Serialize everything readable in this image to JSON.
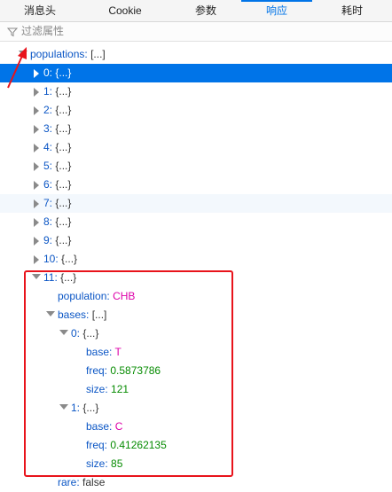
{
  "tabs": [
    {
      "label": "消息头",
      "selected": false
    },
    {
      "label": "Cookie",
      "selected": false
    },
    {
      "label": "参数",
      "selected": false
    },
    {
      "label": "响应",
      "selected": true
    },
    {
      "label": "耗时",
      "selected": false
    }
  ],
  "filter": {
    "placeholder": "过滤属性"
  },
  "tree": {
    "root": {
      "key": "populations:",
      "value": "[...]"
    },
    "items": [
      {
        "key": "0:",
        "value": "{...}"
      },
      {
        "key": "1:",
        "value": "{...}"
      },
      {
        "key": "2:",
        "value": "{...}"
      },
      {
        "key": "3:",
        "value": "{...}"
      },
      {
        "key": "4:",
        "value": "{...}"
      },
      {
        "key": "5:",
        "value": "{...}"
      },
      {
        "key": "6:",
        "value": "{...}"
      },
      {
        "key": "7:",
        "value": "{...}"
      },
      {
        "key": "8:",
        "value": "{...}"
      },
      {
        "key": "9:",
        "value": "{...}"
      },
      {
        "key": "10:",
        "value": "{...}"
      }
    ],
    "item11": {
      "key": "11:",
      "value": "{...}",
      "population": {
        "key": "population:",
        "value": "CHB"
      },
      "bases": {
        "key": "bases:",
        "value": "[...]",
        "b0": {
          "key": "0:",
          "value": "{...}",
          "base": {
            "key": "base:",
            "value": "T"
          },
          "freq": {
            "key": "freq:",
            "value": "0.5873786"
          },
          "size": {
            "key": "size:",
            "value": "121"
          }
        },
        "b1": {
          "key": "1:",
          "value": "{...}",
          "base": {
            "key": "base:",
            "value": "C"
          },
          "freq": {
            "key": "freq:",
            "value": "0.41262135"
          },
          "size": {
            "key": "size:",
            "value": "85"
          }
        }
      },
      "rare": {
        "key": "rare:",
        "value": "false"
      }
    }
  },
  "colors": {
    "accent": "#0074e8",
    "key": "#0b56c5",
    "string": "#dd00a9",
    "number": "#058b00",
    "highlight_box": "#e8131b"
  }
}
